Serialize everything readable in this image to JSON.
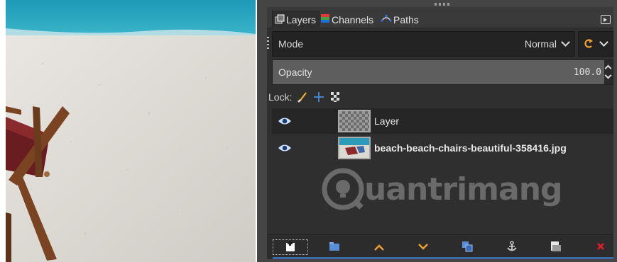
{
  "tabs": [
    {
      "label": "Layers",
      "icon": "layers-icon",
      "active": true
    },
    {
      "label": "Channels",
      "icon": "channels-icon",
      "active": false
    },
    {
      "label": "Paths",
      "icon": "paths-icon",
      "active": false
    }
  ],
  "mode": {
    "label": "Mode",
    "value": "Normal"
  },
  "opacity": {
    "label": "Opacity",
    "value": "100.0"
  },
  "lock": {
    "label": "Lock:",
    "icons": [
      "lock-pixels-icon",
      "lock-position-icon",
      "lock-alpha-icon"
    ]
  },
  "layers": [
    {
      "name": "Layer",
      "visible": true,
      "selected": true,
      "thumb": "transparent"
    },
    {
      "name": "beach-beach-chairs-beautiful-358416.jpg",
      "visible": true,
      "selected": false,
      "thumb": "photo"
    }
  ],
  "watermark": {
    "text": "uantrimang"
  },
  "bottom_buttons": [
    "new-layer-icon",
    "new-layer-group-icon",
    "raise-layer-icon",
    "lower-layer-icon",
    "duplicate-layer-icon",
    "anchor-layer-icon",
    "mask-icon",
    "delete-layer-icon"
  ],
  "colors": {
    "accent": "#3b6aa8",
    "eye": "#cfe3ff",
    "raise": "#f0a030",
    "delete": "#e02020"
  }
}
